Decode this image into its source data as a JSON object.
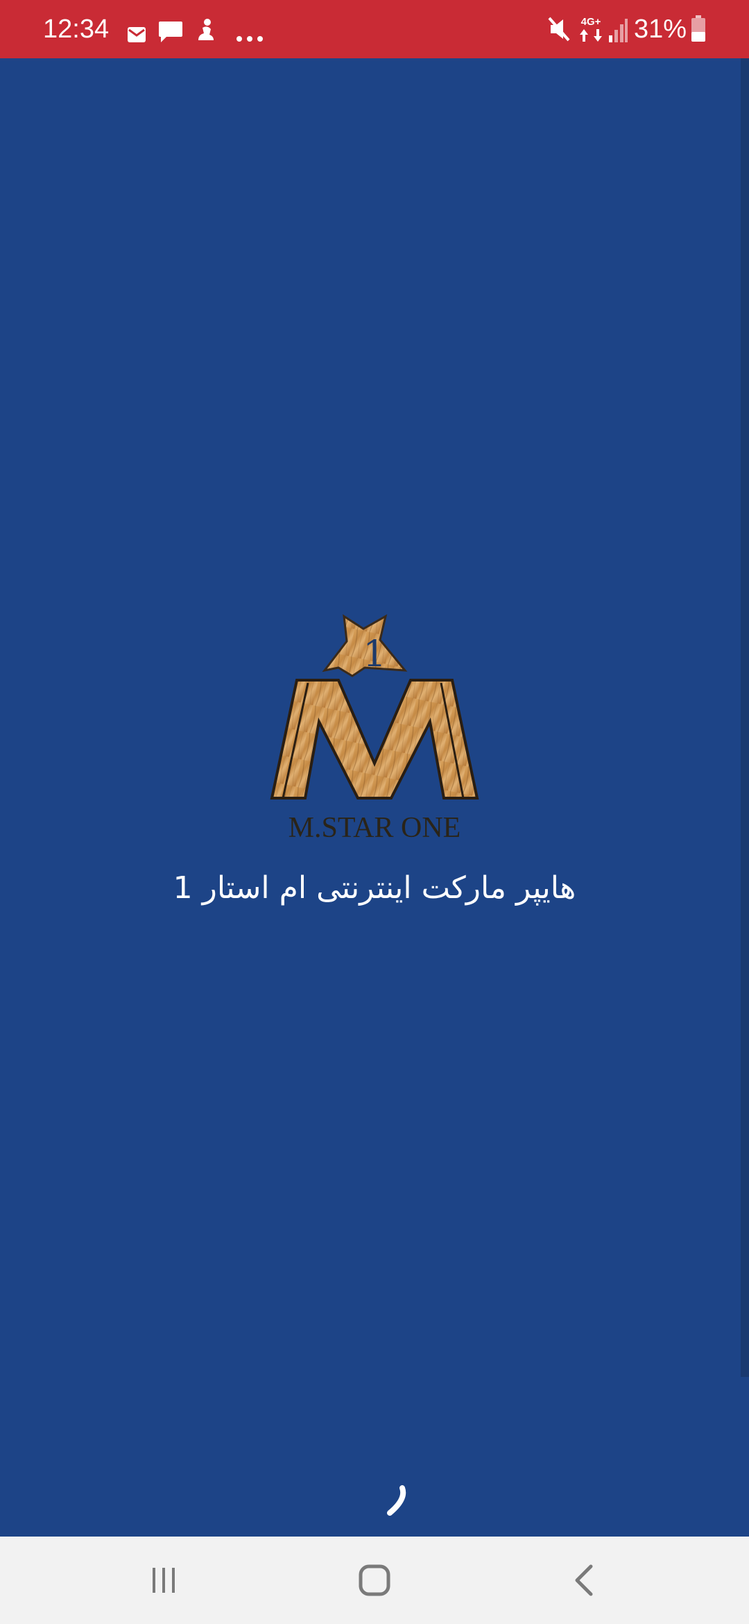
{
  "status_bar": {
    "time": "12:34",
    "battery_percent": "31%",
    "background_color": "#c92b35",
    "left_icons": [
      "mail-icon",
      "chat-icon",
      "figure-icon",
      "more-dots-icon"
    ],
    "right_icons": [
      "mute-icon",
      "network-4g-icon",
      "signal-icon",
      "battery-icon"
    ],
    "network_label": "4G+"
  },
  "splash": {
    "background_color": "#1d4487",
    "logo": {
      "star_number": "1",
      "letter": "M",
      "wordmark": "M.STAR ONE"
    },
    "tagline": "هایپر مارکت اینترنتی ام استار 1"
  },
  "nav_bar": {
    "buttons": [
      "recents-icon",
      "home-icon",
      "back-icon"
    ]
  }
}
